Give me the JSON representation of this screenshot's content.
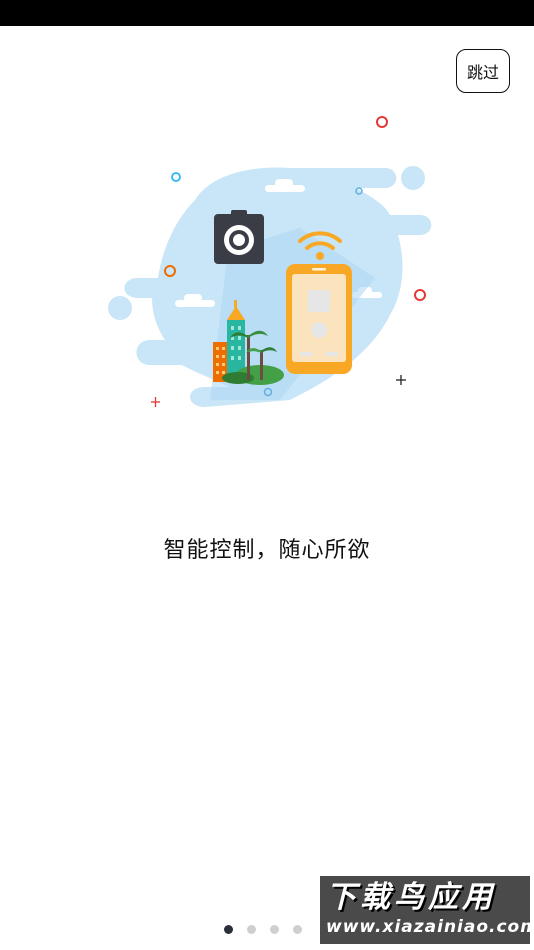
{
  "top_bar": {
    "skip_label": "跳过"
  },
  "illustration": {
    "icons": [
      "camera-icon",
      "wifi-icon",
      "phone-icon",
      "buildings-icon",
      "palm-tree-icon"
    ]
  },
  "slogan": "智能控制，随心所欲",
  "pager": {
    "pages": 4,
    "active_index": 0
  },
  "watermark": {
    "title": "下载鸟应用",
    "url": "www.xiazainiao.com"
  },
  "colors": {
    "background": "#ffffff",
    "cloud_blue": "#c9e6f8",
    "phone_orange": "#f9a825",
    "camera_dark": "#3a3d45",
    "dot_active": "#2b2f3a",
    "dot_inactive": "#cfcfcf"
  }
}
